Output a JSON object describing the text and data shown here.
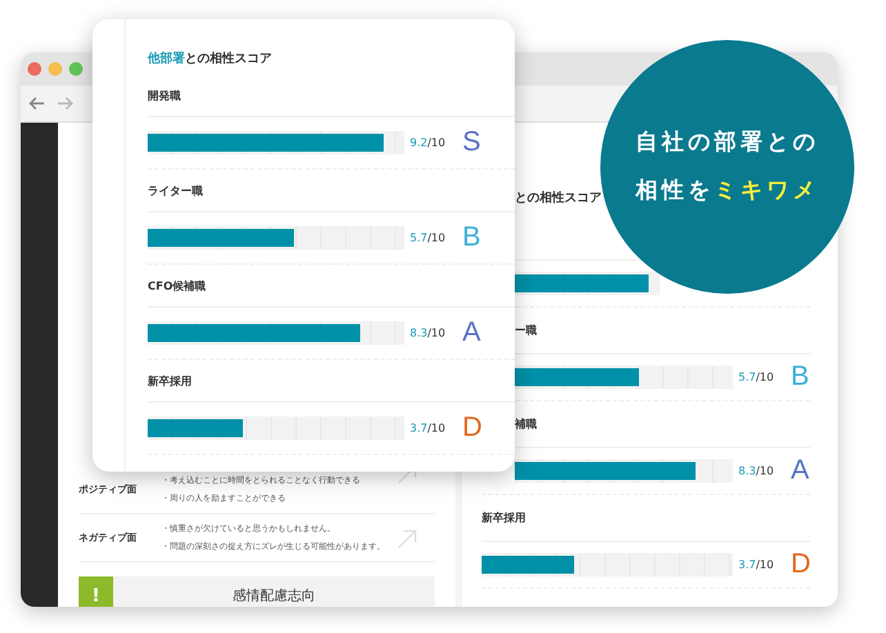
{
  "browser": {
    "left_panel": {
      "traits": [
        {
          "label": "ポジティブ面",
          "lines": [
            "・考え込むことに時間をとられることなく行動できる",
            "・周りの人を励ますことができる"
          ]
        },
        {
          "label": "ネガティブ面",
          "lines": [
            "・慎重さが欠けていると思うかもしれません。",
            "・問題の深刻さの捉え方にズレが生じる可能性があります。"
          ]
        }
      ],
      "banner": {
        "icon": "!",
        "title": "感情配慮志向"
      }
    },
    "right_panel": {
      "heading": "との相性スコア",
      "rows": [
        {
          "level": 0.92
        },
        {
          "label": "ー職",
          "level": 0.57,
          "score": "5.7",
          "max": "/10",
          "grade": "B",
          "color": "#3ab0d4"
        },
        {
          "label": "補職",
          "level": 0.83,
          "score": "8.3",
          "max": "/10",
          "grade": "A",
          "color": "#5a74c4"
        },
        {
          "label": "新卒採用",
          "level": 0.37,
          "score": "3.7",
          "max": "/10",
          "grade": "D",
          "color": "#e06a1e"
        }
      ]
    }
  },
  "card": {
    "title_accent": "他部署",
    "title_rest": "との相性スコア",
    "rows": [
      {
        "label": "開発職",
        "level": 0.92,
        "score": "9.2",
        "max": "/10",
        "grade": "S",
        "color": "#5a74c4"
      },
      {
        "label": "ライター職",
        "level": 0.57,
        "score": "5.7",
        "max": "/10",
        "grade": "B",
        "color": "#3ab0d4"
      },
      {
        "label": "CFO候補職",
        "level": 0.83,
        "score": "8.3",
        "max": "/10",
        "grade": "A",
        "color": "#5a74c4"
      },
      {
        "label": "新卒採用",
        "level": 0.37,
        "score": "3.7",
        "max": "/10",
        "grade": "D",
        "color": "#e06a1e"
      }
    ]
  },
  "badge": {
    "line_1": "自社の部署との",
    "line_2": "相性を",
    "line_2_accent": "ミキワメ"
  }
}
